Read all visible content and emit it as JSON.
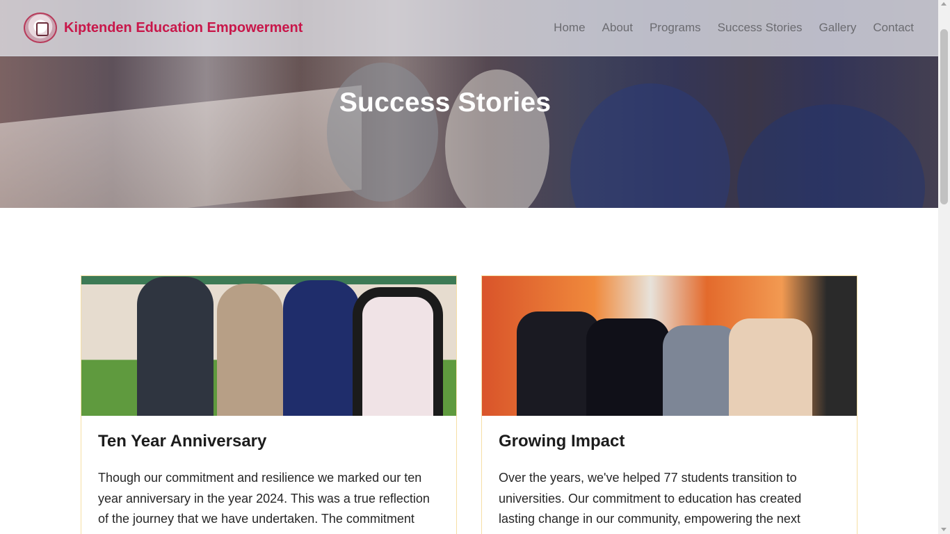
{
  "navbar": {
    "brand_name": "Kiptenden Education Empowerment",
    "links": [
      "Home",
      "About",
      "Programs",
      "Success Stories",
      "Gallery",
      "Contact"
    ],
    "brand_color": "#c8174a"
  },
  "hero": {
    "title": "Success Stories"
  },
  "cards": [
    {
      "title": "Ten Year Anniversary",
      "text": "Though our commitment and resilience we marked our ten year anniversary in the year 2024. This was a true reflection of the journey that we have undertaken. The commitment from both parents and students is what..."
    },
    {
      "title": "Growing Impact",
      "text": "Over the years, we've helped 77 students transition to universities. Our commitment to education has created lasting change in our community, empowering the next generation of leaders."
    }
  ],
  "colors": {
    "card_border": "#f6dfa4",
    "nav_text": "#6b6b70"
  }
}
